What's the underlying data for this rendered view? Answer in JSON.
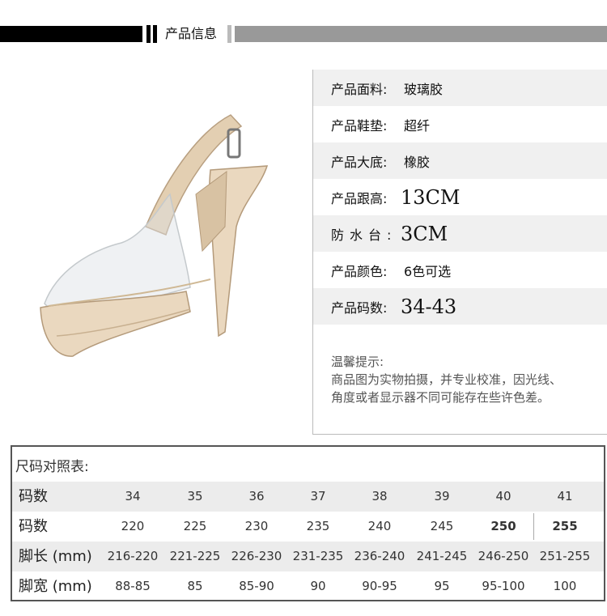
{
  "header": {
    "title": "产品信息"
  },
  "attributes": [
    {
      "label": "产品面料:",
      "value": "玻璃胶"
    },
    {
      "label": "产品鞋垫:",
      "value": "超纤"
    },
    {
      "label": "产品大底:",
      "value": "橡胶"
    },
    {
      "label": "产品跟高:",
      "value": "13CM"
    },
    {
      "label": "防水台:",
      "value": "3CM"
    },
    {
      "label": "产品颜色:",
      "value": "6色可选"
    },
    {
      "label": "产品码数:",
      "value": "34-43"
    }
  ],
  "tips": {
    "title": "温馨提示:",
    "line1": "商品图为实物拍摄，并专业校准，因光线、",
    "line2": "角度或者显示器不同可能存在些许色差。"
  },
  "size_table": {
    "title": "尺码对照表:",
    "rows": [
      {
        "label": "码数",
        "cells": [
          "34",
          "35",
          "36",
          "37",
          "38",
          "39",
          "40",
          "41"
        ]
      },
      {
        "label": "码数",
        "cells": [
          "220",
          "225",
          "230",
          "235",
          "240",
          "245",
          "250",
          "255"
        ]
      },
      {
        "label": "脚长 (mm)",
        "cells": [
          "216-220",
          "221-225",
          "226-230",
          "231-235",
          "236-240",
          "241-245",
          "246-250",
          "251-255"
        ]
      },
      {
        "label": "脚宽 (mm)",
        "cells": [
          "88-85",
          "85",
          "85-90",
          "90",
          "90-95",
          "95",
          "95-100",
          "100"
        ]
      }
    ]
  },
  "colors": {
    "shoe_nude": "#e8d4b8",
    "header_black": "#000000",
    "header_gray": "#999999"
  },
  "icons": {
    "product_image": "clear-platform-sandal"
  }
}
